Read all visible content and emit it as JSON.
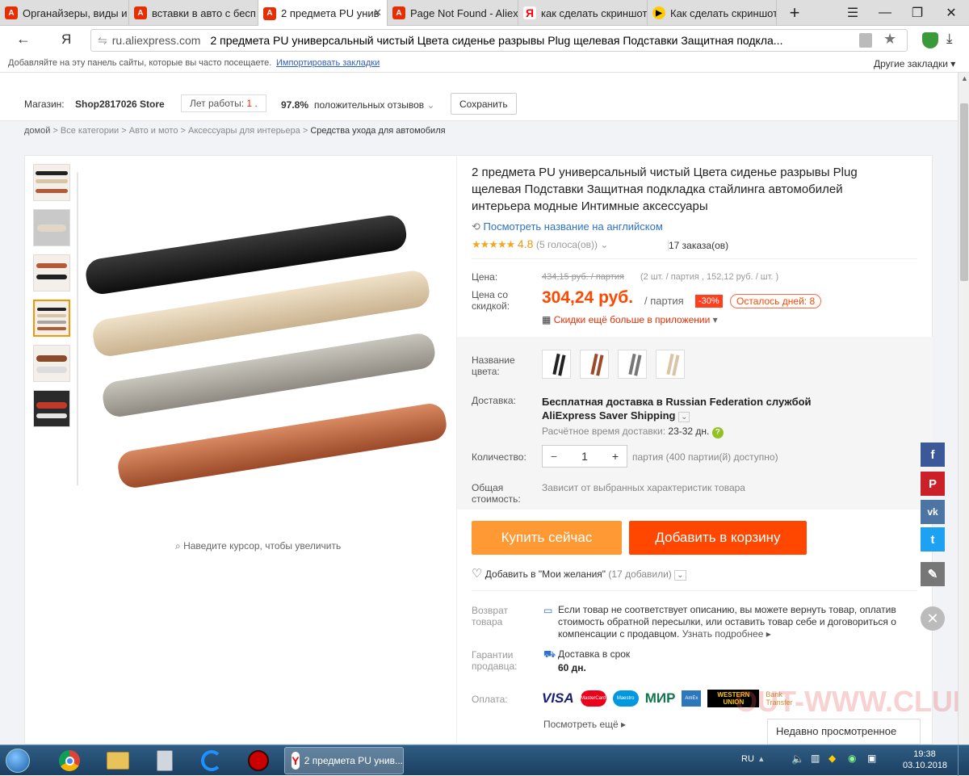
{
  "browser": {
    "tabs": [
      {
        "label": "Органайзеры, виды и",
        "icon": "aliexpress-icon"
      },
      {
        "label": "вставки в авто с бесп",
        "icon": "aliexpress-icon"
      },
      {
        "label": "2 предмета PU унив",
        "icon": "aliexpress-icon"
      },
      {
        "label": "Page Not Found - Aliex",
        "icon": "aliexpress-icon"
      },
      {
        "label": "как сделать скриншот",
        "icon": "yandex-icon"
      },
      {
        "label": "Как сделать скриншот",
        "icon": "video-icon"
      }
    ],
    "url_domain": "ru.aliexpress.com",
    "url_title": "2 предмета PU универсальный чистый Цвета сиденье разрывы Plug щелевая Подставки Защитная подкла...",
    "bookmarks_hint": "Добавляйте на эту панель сайты, которые вы часто посещаете.",
    "import_link": "Импортировать закладки",
    "other_bookmarks": "Другие закладки"
  },
  "store": {
    "label": "Магазин:",
    "name": "Shop2817026 Store",
    "years_label": "Лет работы:",
    "years_value": "1",
    "rating": "97.8%",
    "rating_label": "положительных отзывов",
    "save_label": "Сохранить"
  },
  "breadcrumbs": [
    "домой",
    "Все категории",
    "Авто и мото",
    "Аксессуары для интерьера",
    "Средства ухода для автомобиля"
  ],
  "gallery": {
    "zoom_hint": "Наведите курсор, чтобы увеличить"
  },
  "product": {
    "title": "2 предмета PU универсальный чистый Цвета сиденье разрывы Plug щелевая Подставки Защитная подкладка стайлинга автомобилей интерьера модные Интимные аксессуары",
    "translate_link": "Посмотреть название на английском",
    "rating": "4.8",
    "votes": "(5 голоса(ов))",
    "orders": "17 заказа(ов)",
    "price_label": "Цена:",
    "old_price": "434,15 руб. / партия",
    "old_price_detail": "(2 шт. / партия , 152,12 руб. / шт. )",
    "discount_price_label": "Цена со скидкой:",
    "price": "304,24 руб.",
    "price_unit": "/ партия",
    "discount_badge": "-30%",
    "days_left": "Осталось дней: 8",
    "app_discount": "Скидки ещё больше в приложении",
    "color_label": "Название цвета:",
    "delivery_label": "Доставка:",
    "delivery_text": "Бесплатная доставка в Russian Federation службой AliExpress Saver Shipping",
    "delivery_time_label": "Расчётное время доставки:",
    "delivery_time": "23-32 дн.",
    "qty_label": "Количество:",
    "qty_minus": "−",
    "qty_value": "1",
    "qty_plus": "+",
    "qty_available": "партия (400 партии(й) доступно)",
    "total_label": "Общая стоимость:",
    "total_text": "Зависит от выбранных характеристик товара",
    "buy_now": "Купить сейчас",
    "add_to_cart": "Добавить в корзину",
    "wishlist": "Добавить в \"Мои желания\"",
    "wishlist_count": "(17 добавили)",
    "return_label": "Возврат товара",
    "return_text": "Если товар не соответствует описанию, вы можете вернуть товар, оплатив стоимость обратной пересылки, или оставить товар себе и договориться о компенсации с продавцом.",
    "return_more": "Узнать подробнее",
    "guarantee_label": "Гарантии продавца:",
    "guarantee_text": "Доставка в срок",
    "guarantee_days": "60 дн.",
    "payment_label": "Оплата:",
    "payment_methods": [
      "VISA",
      "MasterCard",
      "Maestro",
      "МИР",
      "AmEx",
      "WESTERN UNION",
      "Bank Transfer"
    ],
    "see_more": "Посмотреть ещё"
  },
  "recently_viewed": "Недавно просмотренное",
  "watermark": "OUT-WWW.CLUB.RU",
  "taskbar": {
    "active_window": "2 предмета PU унив...",
    "lang": "RU",
    "time": "19:38",
    "date": "03.10.2018"
  },
  "colors": {
    "accent": "#ff4747",
    "buy_now": "#ff9933",
    "cart": "#ff4700",
    "link": "#2e72c7"
  }
}
